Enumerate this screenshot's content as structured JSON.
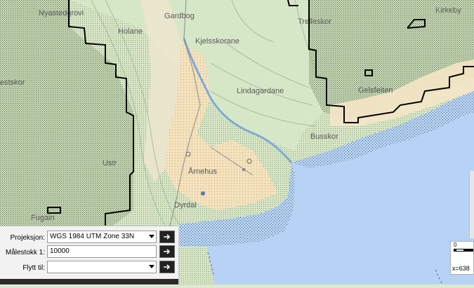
{
  "map": {
    "place_labels": [
      {
        "name": "place-label-nyastedgrovi",
        "text": "Nyastedgrovi"
      },
      {
        "name": "place-label-gardbog",
        "text": "Gardbog"
      },
      {
        "name": "place-label-holane",
        "text": "Holane"
      },
      {
        "name": "place-label-kjelsskorane",
        "text": "Kjelsskorane"
      },
      {
        "name": "place-label-trelleskor",
        "text": "Trelleskor"
      },
      {
        "name": "place-label-kirkeby",
        "text": "Kirkeby"
      },
      {
        "name": "place-label-lindagardane",
        "text": "Lindagardane"
      },
      {
        "name": "place-label-gelsfeiten",
        "text": "Gelsfeiten"
      },
      {
        "name": "place-label-bestskor",
        "text": "estskor"
      },
      {
        "name": "place-label-busskor",
        "text": "Busskor"
      },
      {
        "name": "place-label-ulstrede",
        "text": "Ustr"
      },
      {
        "name": "place-label-arnehus",
        "text": "Årnehus"
      },
      {
        "name": "place-label-dyrdal",
        "text": "Dyrdal"
      },
      {
        "name": "place-label-fugain",
        "text": "Fugain"
      }
    ],
    "colors": {
      "water": "#b6d3f5",
      "forest": "#d5e5c5",
      "field": "#f3dfb8",
      "urban": "#efe6d4",
      "boundary": "#000000"
    }
  },
  "controls": {
    "projection_label": "Projeksjon:",
    "projection_value": "WGS 1984 UTM Zone 33N",
    "scale_label": "Målestokk 1:",
    "scale_value": "10000",
    "move_label": "Flytt til:",
    "move_value": ""
  },
  "scalebar": {
    "zero": "0",
    "coord": "x=638"
  }
}
